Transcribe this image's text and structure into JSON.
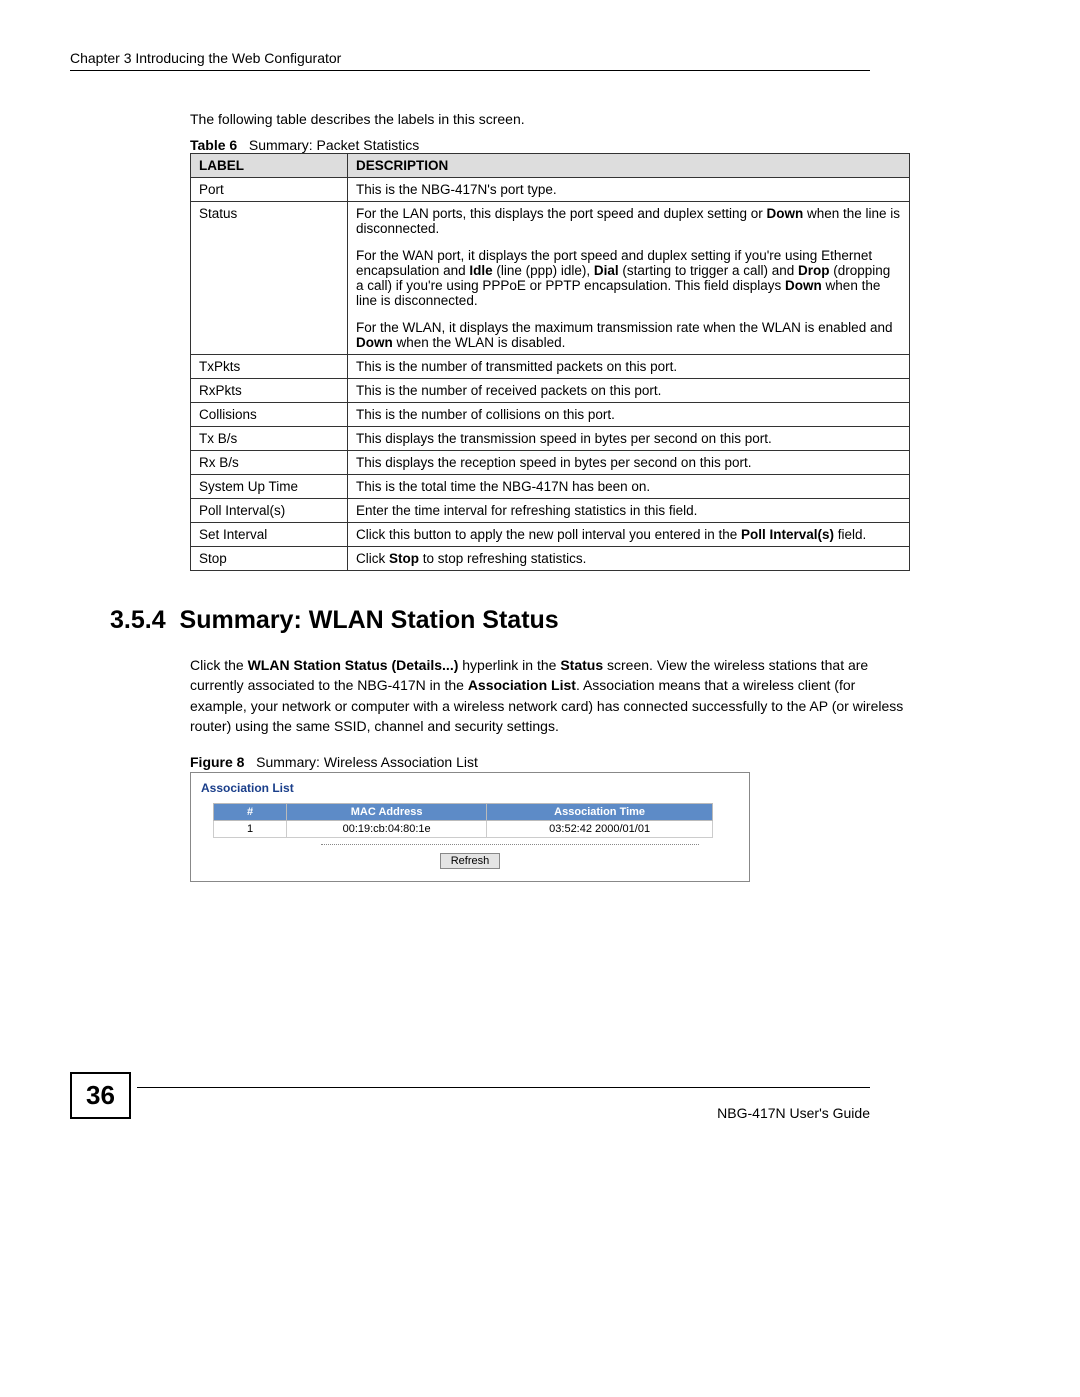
{
  "header": {
    "chapter": "Chapter 3 Introducing the Web Configurator"
  },
  "intro": "The following table describes the labels in this screen.",
  "table6": {
    "caption_prefix": "Table 6",
    "caption_title": "Summary: Packet Statistics",
    "head_label": "LABEL",
    "head_desc": "DESCRIPTION",
    "rows": {
      "port": {
        "label": "Port",
        "desc": "This is the NBG-417N's port type."
      },
      "status": {
        "label": "Status",
        "p1a": "For the LAN ports, this displays the port speed and duplex setting or ",
        "p1b": "Down",
        "p1c": " when the line is disconnected.",
        "p2a": "For the WAN port, it displays the port speed and duplex setting if you're using Ethernet encapsulation and ",
        "p2b": "Idle",
        "p2c": " (line (ppp) idle), ",
        "p2d": "Dial",
        "p2e": " (starting to trigger a call) and ",
        "p2f": "Drop",
        "p2g": " (dropping a call) if you're using PPPoE or PPTP encapsulation. This field displays ",
        "p2h": "Down",
        "p2i": " when the line is disconnected.",
        "p3a": "For the WLAN, it displays the maximum transmission rate when the WLAN is enabled and ",
        "p3b": "Down",
        "p3c": " when the WLAN is disabled."
      },
      "txpkts": {
        "label": "TxPkts",
        "desc": "This is the number of transmitted packets on this port."
      },
      "rxpkts": {
        "label": "RxPkts",
        "desc": "This is the number of received packets on this port."
      },
      "collisions": {
        "label": "Collisions",
        "desc": "This is the number of collisions on this port."
      },
      "txbs": {
        "label": "Tx B/s",
        "desc": "This displays the transmission speed in bytes per second on this port."
      },
      "rxbs": {
        "label": "Rx B/s",
        "desc": "This displays the reception speed in bytes per second on this port."
      },
      "uptime": {
        "label": "System Up Time",
        "desc": "This is the total time the NBG-417N has been on."
      },
      "pollint": {
        "label": "Poll Interval(s)",
        "desc": "Enter the time interval for refreshing statistics in this field."
      },
      "setint": {
        "label": "Set Interval",
        "a": "Click this button to apply the new poll interval you entered in the ",
        "b": "Poll Interval(s)",
        "c": " field."
      },
      "stop": {
        "label": "Stop",
        "a": "Click ",
        "b": "Stop",
        "c": " to stop refreshing statistics."
      }
    }
  },
  "section": {
    "number": "3.5.4",
    "title": "Summary: WLAN Station Status"
  },
  "para": {
    "a": "Click the ",
    "b": "WLAN Station Status (Details...)",
    "c": " hyperlink in the ",
    "d": "Status",
    "e": " screen. View the wireless stations that are currently associated to the NBG-417N in the ",
    "f": "Association List",
    "g": ". Association means that a wireless client (for example, your network or computer with a wireless network card) has connected successfully to the AP (or wireless router) using the same SSID, channel and security settings."
  },
  "figure8": {
    "caption_prefix": "Figure 8",
    "caption_title": "Summary: Wireless Association List",
    "box_title": "Association List",
    "head_num": "#",
    "head_mac": "MAC Address",
    "head_time": "Association Time",
    "row1_num": "1",
    "row1_mac": "00:19:cb:04:80:1e",
    "row1_time": "03:52:42 2000/01/01",
    "refresh": "Refresh"
  },
  "footer": {
    "page": "36",
    "guide": "NBG-417N User's Guide"
  }
}
